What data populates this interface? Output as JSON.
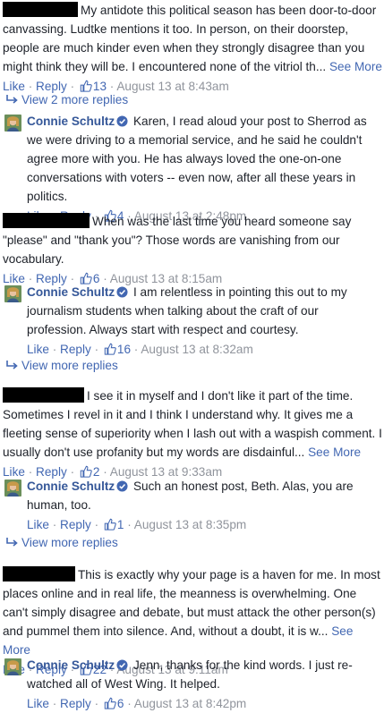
{
  "labels": {
    "like": "Like",
    "reply": "Reply",
    "dot": " · "
  },
  "comments": [
    {
      "text": "My antidote this political season has been door-to-door canvassing. Ludtke mentions it too. In person, on their doorstep, people are much kinder even when they strongly disagree than you might think they will be. I encountered none of the vitriol th...",
      "see_more": "See More",
      "likes": "13",
      "time": "August 13 at 8:43am",
      "replies_link": "View 2 more replies",
      "reply": {
        "author": "Connie Schultz",
        "text": "Karen, I read aloud your post to Sherrod as we were driving to a memorial service, and he said he couldn't agree more with you. He has always loved the one-on-one conversations with voters -- even now, after all these years in politics.",
        "likes": "4",
        "time": "August 13 at 2:48pm"
      }
    },
    {
      "text": "When was the last time you heard someone say \"please\" and \"thank you\"? Those words are vanishing from our vocabulary.",
      "likes": "6",
      "time": "August 13 at 8:15am",
      "reply": {
        "author": "Connie Schultz",
        "text": "I am relentless in pointing this out to my journalism students when talking about the craft of our profession. Always start with respect and courtesy.",
        "likes": "16",
        "time": "August 13 at 8:32am"
      },
      "replies_link": "View more replies"
    },
    {
      "text": "I see it in myself and I don't like it part of the time. Sometimes I revel in it and I think I understand why. It gives me a fleeting sense of superiority when I lash out with a waspish comment. I usually don't use profanity but my words are disdainful...",
      "see_more": "See More",
      "likes": "2",
      "time": "August 13 at 9:33am",
      "reply": {
        "author": "Connie Schultz",
        "text": "Such an honest post, Beth. Alas, you are human, too.",
        "likes": "1",
        "time": "August 13 at 8:35pm"
      },
      "replies_link": "View more replies"
    },
    {
      "text": "This is exactly why your page is a haven for me. In most places online and in real life, the meanness is overwhelming. One can't simply disagree and debate, but must attack the other person(s) and pummel them into silence. And, without a doubt, it is w...",
      "see_more": "See More",
      "likes": "22",
      "time": "August 13 at 9:11am",
      "reply": {
        "author": "Connie Schultz",
        "text": "Jenn, thanks for the kind words. I just re-watched all of West Wing. It helped.",
        "likes": "6",
        "time": "August 13 at 8:42pm"
      }
    }
  ]
}
